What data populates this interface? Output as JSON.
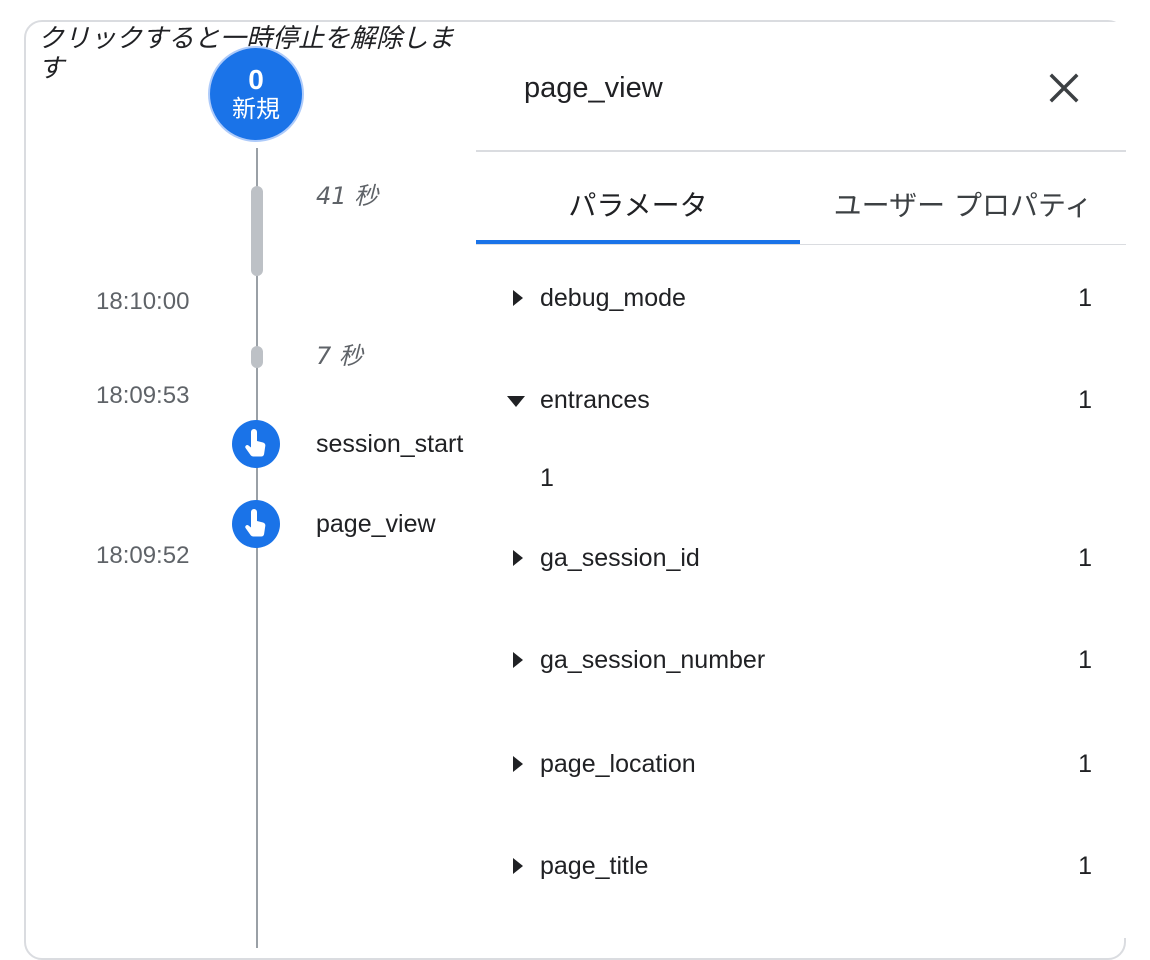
{
  "resume_hint": "クリックすると一時停止を解除します",
  "new_badge": {
    "count": "0",
    "label": "新規"
  },
  "timeline": {
    "gaps": [
      {
        "label": "41 秒"
      },
      {
        "label": "7 秒"
      }
    ],
    "times": [
      "18:10:00",
      "18:09:53",
      "18:09:52"
    ],
    "events": [
      {
        "name": "session_start",
        "icon": "touch-icon"
      },
      {
        "name": "page_view",
        "icon": "touch-icon"
      }
    ]
  },
  "panel": {
    "title": "page_view",
    "close_icon": "close-icon",
    "tabs": [
      {
        "label": "パラメータ",
        "active": true
      },
      {
        "label": "ユーザー プロパティ",
        "active": false
      }
    ],
    "params": [
      {
        "name": "debug_mode",
        "value": "1",
        "expanded": false
      },
      {
        "name": "entrances",
        "value": "1",
        "expanded": true,
        "detail": "1"
      },
      {
        "name": "ga_session_id",
        "value": "1",
        "expanded": false
      },
      {
        "name": "ga_session_number",
        "value": "1",
        "expanded": false
      },
      {
        "name": "page_location",
        "value": "1",
        "expanded": false
      },
      {
        "name": "page_title",
        "value": "1",
        "expanded": false
      }
    ]
  },
  "colors": {
    "accent": "#1a73e8",
    "timeline": "#9aa0a6",
    "gap": "#bdc1c6"
  }
}
